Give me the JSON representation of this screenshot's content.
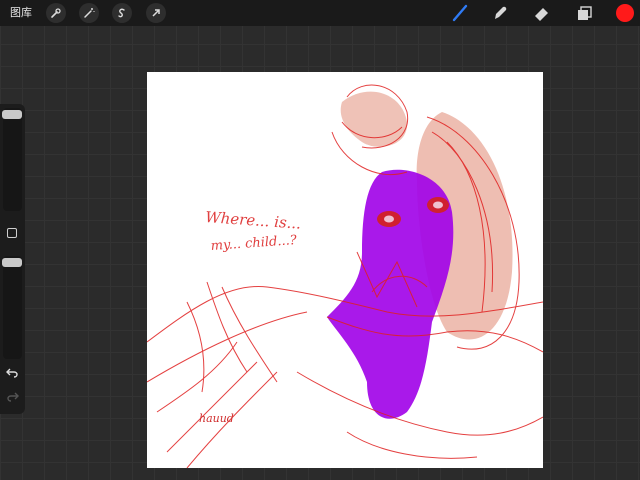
{
  "toolbar": {
    "gallery_label": "图库",
    "left_tools": [
      "wrench-icon",
      "magic-wand-icon",
      "selection-icon",
      "transform-arrow-icon"
    ],
    "right_tools": [
      "brush-icon",
      "smudge-icon",
      "eraser-icon",
      "layers-icon"
    ],
    "active_tool": "brush-icon",
    "active_tool_color": "#2f7bf5",
    "current_color": "#ff1a1a"
  },
  "sidebar": {
    "brush_size_level": 0.0,
    "opacity_level": 0.0,
    "icons": [
      "modify-square-icon",
      "undo-icon",
      "redo-icon"
    ]
  },
  "canvas": {
    "background": "#ffffff",
    "sketch_text_1": "Where... is...",
    "sketch_text_2": "my... child...?",
    "signature": "hauud",
    "colors": {
      "line": "#e02020",
      "fill_purple": "#a000e8",
      "fill_pink": "#e8a898"
    }
  }
}
